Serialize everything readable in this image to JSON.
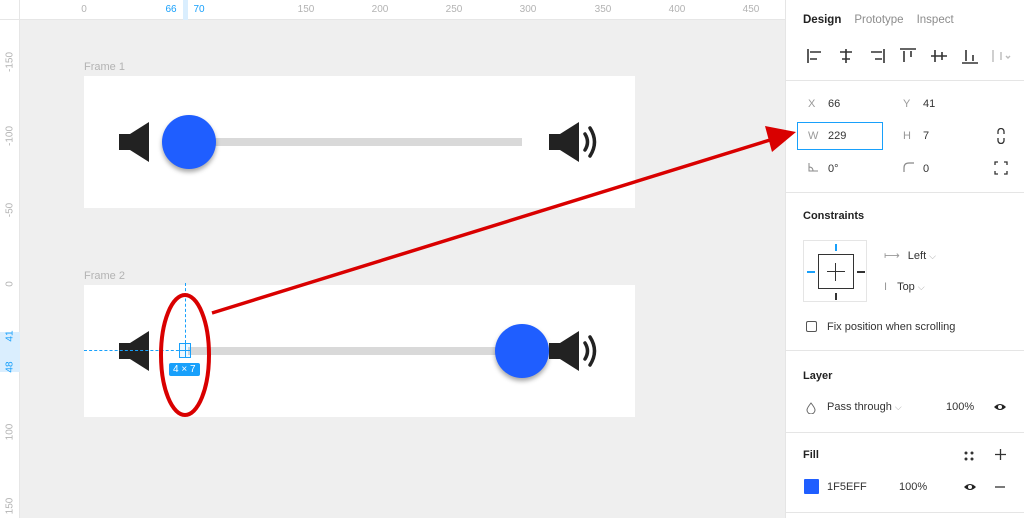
{
  "canvas": {
    "ruler_top": [
      {
        "label": "0"
      },
      {
        "label": "66",
        "hl": true
      },
      {
        "label": "70",
        "hl": true
      },
      {
        "label": "150"
      },
      {
        "label": "200"
      },
      {
        "label": "250"
      },
      {
        "label": "300"
      },
      {
        "label": "350"
      },
      {
        "label": "400"
      },
      {
        "label": "450"
      }
    ],
    "ruler_left": [
      {
        "label": "-150"
      },
      {
        "label": "-100"
      },
      {
        "label": "-50"
      },
      {
        "label": "0"
      },
      {
        "label": "41",
        "hl": true
      },
      {
        "label": "48",
        "hl": true
      },
      {
        "label": "100"
      },
      {
        "label": "150"
      }
    ],
    "frame1_label": "Frame 1",
    "frame2_label": "Frame 2",
    "selection_size": "4 × 7",
    "knob_color": "#1f5eff",
    "annotation_color": "#d90000",
    "slider1_level": 0.0,
    "slider2_level": 1.0
  },
  "panel": {
    "tabs": [
      "Design",
      "Prototype",
      "Inspect"
    ],
    "x_label": "X",
    "x_value": "66",
    "y_label": "Y",
    "y_value": "41",
    "w_label": "W",
    "w_value": "229",
    "h_label": "H",
    "h_value": "7",
    "rotation_value": "0°",
    "radius_value": "0",
    "constraints_title": "Constraints",
    "constraint_h": "Left",
    "constraint_v": "Top",
    "fix_position_label": "Fix position when scrolling",
    "layer_title": "Layer",
    "blend_mode": "Pass through",
    "layer_opacity": "100%",
    "fill_title": "Fill",
    "fill_hex": "1F5EFF",
    "fill_opacity": "100%",
    "fill_color": "#1f5eff"
  }
}
